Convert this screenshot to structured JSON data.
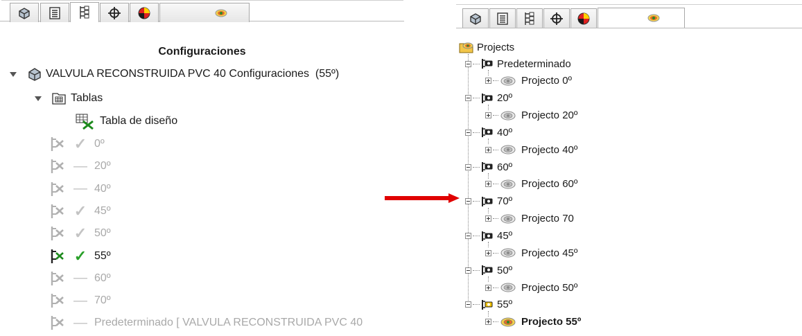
{
  "left_panel": {
    "tabs": [
      "part-icon",
      "list-icon",
      "tree-icon",
      "crosshair-icon",
      "appearance-icon",
      "projects-icon"
    ],
    "title": "Configuraciones",
    "root_label": "VALVULA RECONSTRUIDA PVC 40 Configuraciones  (55º)",
    "folder_label": "Tablas",
    "design_table_label": "Tabla de diseño",
    "configurations": [
      {
        "label": "0º",
        "mark": "✓",
        "active": false
      },
      {
        "label": "20º",
        "mark": "—",
        "active": false
      },
      {
        "label": "40º",
        "mark": "—",
        "active": false
      },
      {
        "label": "45º",
        "mark": "✓",
        "active": false
      },
      {
        "label": "50º",
        "mark": "✓",
        "active": false
      },
      {
        "label": "55º",
        "mark": "✓",
        "active": true
      },
      {
        "label": "60º",
        "mark": "—",
        "active": false
      },
      {
        "label": "70º",
        "mark": "—",
        "active": false
      },
      {
        "label": "Predeterminado [ VALVULA RECONSTRUIDA PVC 40",
        "mark": "—",
        "active": false
      }
    ]
  },
  "right_panel": {
    "tabs": [
      "part-icon",
      "list-icon",
      "tree-icon",
      "crosshair-icon",
      "appearance-icon",
      "projects-icon"
    ],
    "root_label": "Projects",
    "groups": [
      {
        "config": "Predeterminado",
        "project": "Projecto 0º"
      },
      {
        "config": "20º",
        "project": "Projecto 20º"
      },
      {
        "config": "40º",
        "project": "Projecto 40º"
      },
      {
        "config": "60º",
        "project": "Projecto 60º"
      },
      {
        "config": "70º",
        "project": "Projecto 70"
      },
      {
        "config": "45º",
        "project": "Projecto 45º"
      },
      {
        "config": "50º",
        "project": "Projecto 50º"
      },
      {
        "config": "55º",
        "project": "Projecto 55º",
        "bold": true
      }
    ]
  },
  "colors": {
    "arrow": "#e00000",
    "check_active": "#2aa02a",
    "inactive": "#a9a9a9"
  }
}
